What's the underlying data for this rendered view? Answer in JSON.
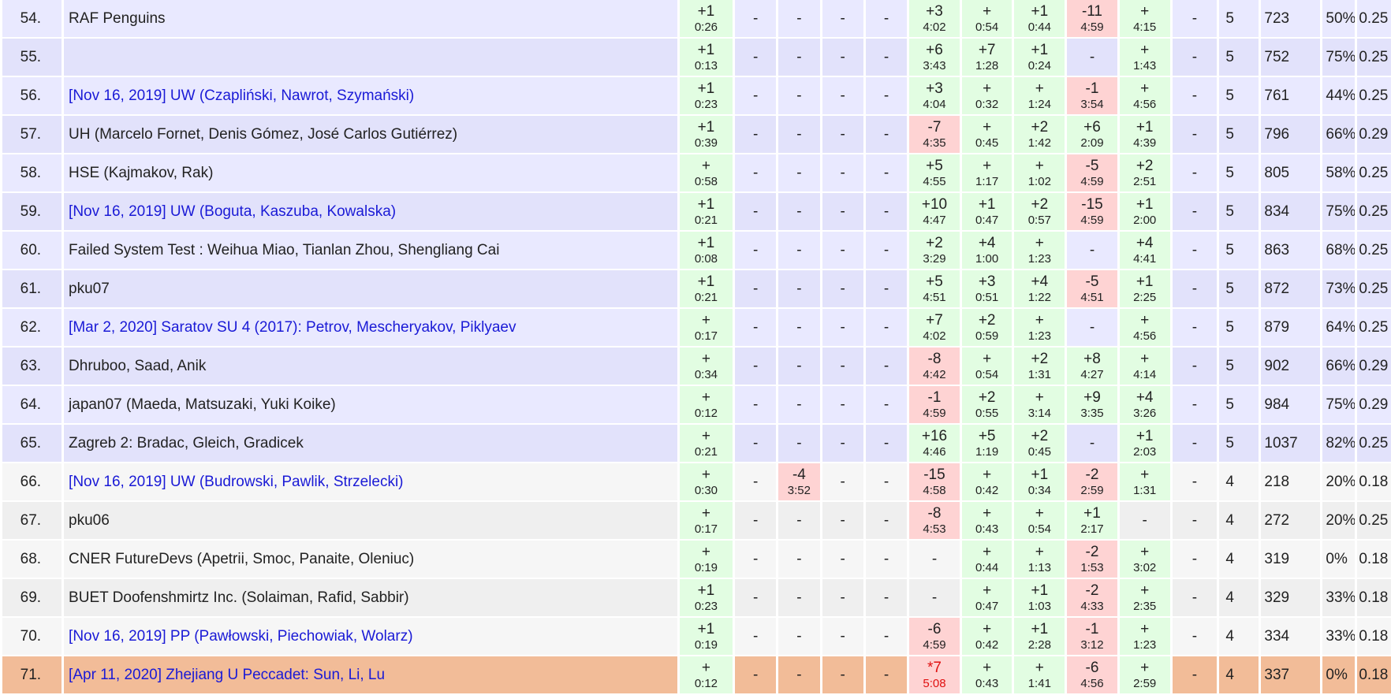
{
  "rows": [
    {
      "rank": "54.",
      "party": "RAF Penguins",
      "link": false,
      "cells": [
        [
          "+1",
          "0:26"
        ],
        "-",
        "-",
        "-",
        "-",
        [
          "+3",
          "4:02"
        ],
        [
          "+",
          "0:54"
        ],
        [
          "+1",
          "0:44"
        ],
        [
          "-11",
          "4:59",
          "fail"
        ],
        [
          "+",
          "4:15"
        ],
        "-"
      ],
      "solved": "5",
      "penalty": "723",
      "pct": "50%",
      "rating": "0.25",
      "group": 5
    },
    {
      "rank": "55.",
      "party": "",
      "link": false,
      "cells": [
        [
          "+1",
          "0:13"
        ],
        "-",
        "-",
        "-",
        "-",
        [
          "+6",
          "3:43"
        ],
        [
          "+7",
          "1:28"
        ],
        [
          "+1",
          "0:24"
        ],
        "-",
        [
          "+",
          "1:43"
        ],
        "-"
      ],
      "solved": "5",
      "penalty": "752",
      "pct": "75%",
      "rating": "0.25",
      "group": 5
    },
    {
      "rank": "56.",
      "party": "[Nov 16, 2019] UW (Czapliński, Nawrot, Szymański)",
      "link": true,
      "cells": [
        [
          "+1",
          "0:23"
        ],
        "-",
        "-",
        "-",
        "-",
        [
          "+3",
          "4:04"
        ],
        [
          "+",
          "0:32"
        ],
        [
          "+",
          "1:24"
        ],
        [
          "-1",
          "3:54",
          "fail"
        ],
        [
          "+",
          "4:56"
        ],
        "-"
      ],
      "solved": "5",
      "penalty": "761",
      "pct": "44%",
      "rating": "0.25",
      "group": 5
    },
    {
      "rank": "57.",
      "party": "UH (Marcelo Fornet, Denis Gómez, José Carlos Gutiérrez)",
      "link": false,
      "cells": [
        [
          "+1",
          "0:39"
        ],
        "-",
        "-",
        "-",
        "-",
        [
          "-7",
          "4:35",
          "fail"
        ],
        [
          "+",
          "0:45"
        ],
        [
          "+2",
          "1:42"
        ],
        [
          "+6",
          "2:09"
        ],
        [
          "+1",
          "4:39"
        ],
        "-"
      ],
      "solved": "5",
      "penalty": "796",
      "pct": "66%",
      "rating": "0.29",
      "group": 5
    },
    {
      "rank": "58.",
      "party": "HSE (Kajmakov, Rak)",
      "link": false,
      "cells": [
        [
          "+",
          "0:58"
        ],
        "-",
        "-",
        "-",
        "-",
        [
          "+5",
          "4:55"
        ],
        [
          "+",
          "1:17"
        ],
        [
          "+",
          "1:02"
        ],
        [
          "-5",
          "4:59",
          "fail"
        ],
        [
          "+2",
          "2:51"
        ],
        "-"
      ],
      "solved": "5",
      "penalty": "805",
      "pct": "58%",
      "rating": "0.25",
      "group": 5
    },
    {
      "rank": "59.",
      "party": "[Nov 16, 2019] UW (Boguta, Kaszuba, Kowalska)",
      "link": true,
      "cells": [
        [
          "+1",
          "0:21"
        ],
        "-",
        "-",
        "-",
        "-",
        [
          "+10",
          "4:47"
        ],
        [
          "+1",
          "0:47"
        ],
        [
          "+2",
          "0:57"
        ],
        [
          "-15",
          "4:59",
          "fail"
        ],
        [
          "+1",
          "2:00"
        ],
        "-"
      ],
      "solved": "5",
      "penalty": "834",
      "pct": "75%",
      "rating": "0.25",
      "group": 5
    },
    {
      "rank": "60.",
      "party": "Failed System Test : Weihua Miao, Tianlan Zhou, Shengliang Cai",
      "link": false,
      "cells": [
        [
          "+1",
          "0:08"
        ],
        "-",
        "-",
        "-",
        "-",
        [
          "+2",
          "3:29"
        ],
        [
          "+4",
          "1:00"
        ],
        [
          "+",
          "1:23"
        ],
        "-",
        [
          "+4",
          "4:41"
        ],
        "-"
      ],
      "solved": "5",
      "penalty": "863",
      "pct": "68%",
      "rating": "0.25",
      "group": 5
    },
    {
      "rank": "61.",
      "party": "pku07",
      "link": false,
      "cells": [
        [
          "+1",
          "0:21"
        ],
        "-",
        "-",
        "-",
        "-",
        [
          "+5",
          "4:51"
        ],
        [
          "+3",
          "0:51"
        ],
        [
          "+4",
          "1:22"
        ],
        [
          "-5",
          "4:51",
          "fail"
        ],
        [
          "+1",
          "2:25"
        ],
        "-"
      ],
      "solved": "5",
      "penalty": "872",
      "pct": "73%",
      "rating": "0.25",
      "group": 5
    },
    {
      "rank": "62.",
      "party": "[Mar 2, 2020] Saratov SU 4 (2017): Petrov, Mescheryakov, Piklyaev",
      "link": true,
      "cells": [
        [
          "+",
          "0:17"
        ],
        "-",
        "-",
        "-",
        "-",
        [
          "+7",
          "4:02"
        ],
        [
          "+2",
          "0:59"
        ],
        [
          "+",
          "1:23"
        ],
        "-",
        [
          "+",
          "4:56"
        ],
        "-"
      ],
      "solved": "5",
      "penalty": "879",
      "pct": "64%",
      "rating": "0.25",
      "group": 5
    },
    {
      "rank": "63.",
      "party": "Dhruboo, Saad, Anik",
      "link": false,
      "cells": [
        [
          "+",
          "0:34"
        ],
        "-",
        "-",
        "-",
        "-",
        [
          "-8",
          "4:42",
          "fail"
        ],
        [
          "+",
          "0:54"
        ],
        [
          "+2",
          "1:31"
        ],
        [
          "+8",
          "4:27"
        ],
        [
          "+",
          "4:14"
        ],
        "-"
      ],
      "solved": "5",
      "penalty": "902",
      "pct": "66%",
      "rating": "0.29",
      "group": 5
    },
    {
      "rank": "64.",
      "party": "japan07 (Maeda, Matsuzaki, Yuki Koike)",
      "link": false,
      "cells": [
        [
          "+",
          "0:12"
        ],
        "-",
        "-",
        "-",
        "-",
        [
          "-1",
          "4:59",
          "fail"
        ],
        [
          "+2",
          "0:55"
        ],
        [
          "+",
          "3:14"
        ],
        [
          "+9",
          "3:35"
        ],
        [
          "+4",
          "3:26"
        ],
        "-"
      ],
      "solved": "5",
      "penalty": "984",
      "pct": "75%",
      "rating": "0.29",
      "group": 5
    },
    {
      "rank": "65.",
      "party": "Zagreb 2: Bradac, Gleich, Gradicek",
      "link": false,
      "cells": [
        [
          "+",
          "0:21"
        ],
        "-",
        "-",
        "-",
        "-",
        [
          "+16",
          "4:46"
        ],
        [
          "+5",
          "1:19"
        ],
        [
          "+2",
          "0:45"
        ],
        "-",
        [
          "+1",
          "2:03"
        ],
        "-"
      ],
      "solved": "5",
      "penalty": "1037",
      "pct": "82%",
      "rating": "0.25",
      "group": 5
    },
    {
      "rank": "66.",
      "party": "[Nov 16, 2019] UW (Budrowski, Pawlik, Strzelecki)",
      "link": true,
      "cells": [
        [
          "+",
          "0:30"
        ],
        "-",
        [
          "-4",
          "3:52",
          "fail"
        ],
        "-",
        "-",
        [
          "-15",
          "4:58",
          "fail"
        ],
        [
          "+",
          "0:42"
        ],
        [
          "+1",
          "0:34"
        ],
        [
          "-2",
          "2:59",
          "fail"
        ],
        [
          "+",
          "1:31"
        ],
        "-"
      ],
      "solved": "4",
      "penalty": "218",
      "pct": "20%",
      "rating": "0.18",
      "group": 4
    },
    {
      "rank": "67.",
      "party": "pku06",
      "link": false,
      "cells": [
        [
          "+",
          "0:17"
        ],
        "-",
        "-",
        "-",
        "-",
        [
          "-8",
          "4:53",
          "fail"
        ],
        [
          "+",
          "0:43"
        ],
        [
          "+",
          "0:54"
        ],
        [
          "+1",
          "2:17"
        ],
        "-",
        "-"
      ],
      "solved": "4",
      "penalty": "272",
      "pct": "20%",
      "rating": "0.25",
      "group": 4
    },
    {
      "rank": "68.",
      "party": "CNER FutureDevs (Apetrii, Smoc, Panaite, Oleniuc)",
      "link": false,
      "cells": [
        [
          "+",
          "0:19"
        ],
        "-",
        "-",
        "-",
        "-",
        "-",
        [
          "+",
          "0:44"
        ],
        [
          "+",
          "1:13"
        ],
        [
          "-2",
          "1:53",
          "fail"
        ],
        [
          "+",
          "3:02"
        ],
        "-"
      ],
      "solved": "4",
      "penalty": "319",
      "pct": "0%",
      "rating": "0.18",
      "group": 4
    },
    {
      "rank": "69.",
      "party": "BUET Doofenshmirtz Inc. (Solaiman, Rafid, Sabbir)",
      "link": false,
      "cells": [
        [
          "+1",
          "0:23"
        ],
        "-",
        "-",
        "-",
        "-",
        "-",
        [
          "+",
          "0:47"
        ],
        [
          "+1",
          "1:03"
        ],
        [
          "-2",
          "4:33",
          "fail"
        ],
        [
          "+",
          "2:35"
        ],
        "-"
      ],
      "solved": "4",
      "penalty": "329",
      "pct": "33%",
      "rating": "0.18",
      "group": 4
    },
    {
      "rank": "70.",
      "party": "[Nov 16, 2019] PP (Pawłowski, Piechowiak, Wolarz)",
      "link": true,
      "cells": [
        [
          "+1",
          "0:19"
        ],
        "-",
        "-",
        "-",
        "-",
        [
          "-6",
          "4:59",
          "fail"
        ],
        [
          "+",
          "0:42"
        ],
        [
          "+1",
          "2:28"
        ],
        [
          "-1",
          "3:12",
          "fail"
        ],
        [
          "+",
          "1:23"
        ],
        "-"
      ],
      "solved": "4",
      "penalty": "334",
      "pct": "33%",
      "rating": "0.18",
      "group": 4
    },
    {
      "rank": "71.",
      "party": "[Apr 11, 2020] Zhejiang U Peccadet: Sun, Li, Lu",
      "link": true,
      "highlight": true,
      "cells": [
        [
          "+",
          "0:12"
        ],
        "-",
        "-",
        "-",
        "-",
        [
          "*7",
          "5:08",
          "fail",
          "frozen"
        ],
        [
          "+",
          "0:43"
        ],
        [
          "+",
          "1:41"
        ],
        [
          "-6",
          "4:56",
          "fail"
        ],
        [
          "+",
          "2:59"
        ],
        "-"
      ],
      "solved": "4",
      "penalty": "337",
      "pct": "0%",
      "rating": "0.18",
      "group": 4
    }
  ],
  "colors": {
    "solved_cell": "#e2fde2",
    "failed_cell": "#fed3d3",
    "row_group5": "#e9e9ff",
    "row_group4": "#f6f6f6",
    "row_highlight": "#f2bc98",
    "link": "#1a1ad6",
    "frozen_text": "#e01010"
  }
}
